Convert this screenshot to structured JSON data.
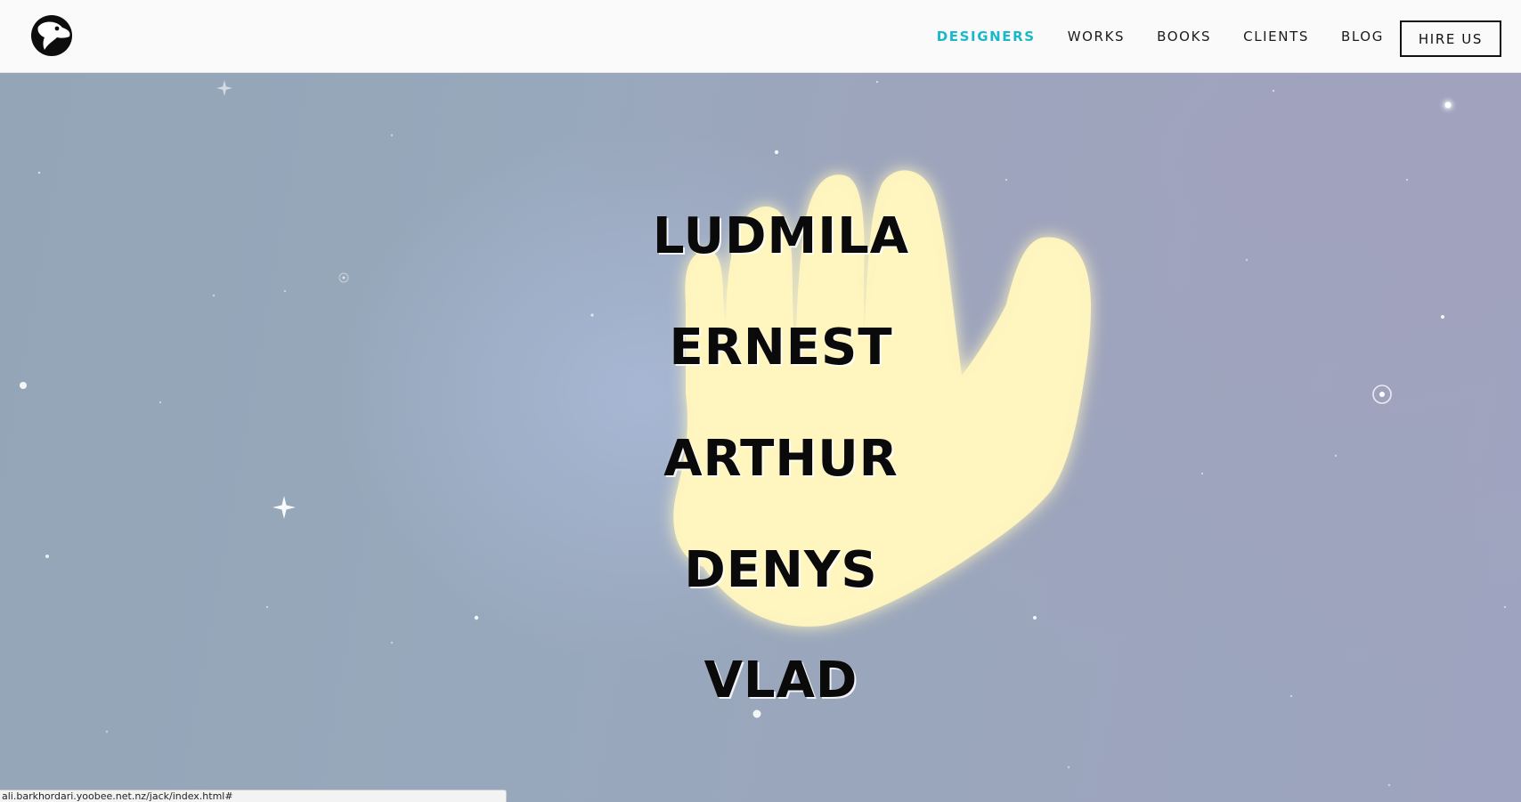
{
  "header": {
    "logo_icon": "bird-head-icon",
    "nav": [
      {
        "label": "DESIGNERS",
        "active": true
      },
      {
        "label": "WORKS",
        "active": false
      },
      {
        "label": "BOOKS",
        "active": false
      },
      {
        "label": "CLIENTS",
        "active": false
      },
      {
        "label": "BLOG",
        "active": false
      }
    ],
    "cta_label": "HIRE US"
  },
  "hero": {
    "illustration_icon": "glowing-hand-icon",
    "names": [
      "LUDMILA",
      "ERNEST",
      "ARTHUR",
      "DENYS",
      "VLAD"
    ]
  },
  "status_bar": {
    "url": "ali.barkhordari.yoobee.net.nz/jack/index.html#"
  },
  "colors": {
    "accent": "#1ab8c8",
    "hand_glow": "#fff6c0",
    "sky": "#98a8bc"
  }
}
